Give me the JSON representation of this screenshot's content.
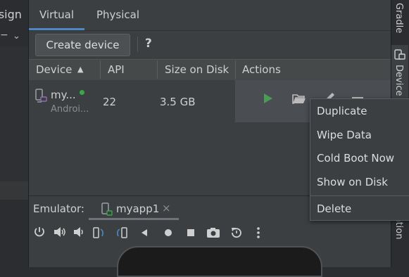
{
  "left_panel": {
    "header_text": "esign",
    "collapse_label": "−",
    "chevron": "⌄"
  },
  "tabs": [
    {
      "label": "Virtual",
      "active": true
    },
    {
      "label": "Physical",
      "active": false
    }
  ],
  "toolbar": {
    "create_label": "Create device",
    "help_label": "?"
  },
  "table": {
    "columns": [
      "Device",
      "API",
      "Size on Disk",
      "Actions"
    ],
    "sort_indicator": "▲",
    "rows": [
      {
        "name": "my...",
        "subtitle": "Androi...",
        "api": "22",
        "size": "3.5 GB",
        "online": true
      }
    ]
  },
  "context_menu": {
    "items": [
      "Duplicate",
      "Wipe Data",
      "Cold Boot Now",
      "Show on Disk",
      "Delete"
    ]
  },
  "emulator": {
    "label": "Emulator:",
    "tab_label": "myapp1",
    "close_glyph": "×"
  },
  "right_strip": {
    "top_label": "Gradle",
    "device_manager_label": "Device M",
    "bottom_label": "lation"
  },
  "colors": {
    "accent": "#4a88c7",
    "run": "#499c54",
    "online": "#3aa64a"
  },
  "icons": {
    "emulator_controls": [
      "power-icon",
      "volume-up-icon",
      "volume-down-icon",
      "rotate-left-icon",
      "rotate-right-icon",
      "back-icon",
      "home-icon",
      "overview-icon",
      "screenshot-icon",
      "snapshot-icon",
      "more-icon"
    ]
  }
}
